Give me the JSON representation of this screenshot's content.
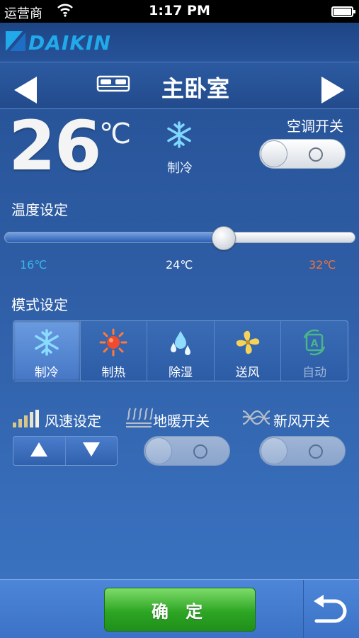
{
  "status": {
    "carrier": "运营商",
    "time": "1:17 PM"
  },
  "brand": {
    "name": "DAIKIN"
  },
  "room": {
    "title": "主卧室"
  },
  "current": {
    "temperature": "26",
    "unit": "℃",
    "mode_label": "制冷"
  },
  "power": {
    "label": "空调开关",
    "on": false
  },
  "temperature_setting": {
    "label": "温度设定",
    "min_label": "16℃",
    "mid_label": "24℃",
    "max_label": "32℃",
    "min": 16,
    "max": 32,
    "value": 26,
    "colors": {
      "min": "#39b7ea",
      "mid": "#ffffff",
      "max": "#f2743a"
    }
  },
  "mode_setting": {
    "label": "模式设定",
    "modes": [
      {
        "label": "制冷",
        "icon": "snowflake-icon",
        "active": true
      },
      {
        "label": "制热",
        "icon": "sun-icon",
        "active": false
      },
      {
        "label": "除湿",
        "icon": "water-drops-icon",
        "active": false
      },
      {
        "label": "送风",
        "icon": "fan-icon",
        "active": false
      },
      {
        "label": "自动",
        "icon": "auto-icon",
        "active": false,
        "disabled": true
      }
    ]
  },
  "features": {
    "fan_speed": {
      "label": "风速设定",
      "icon": "signal-bars-icon"
    },
    "floor_heating": {
      "label": "地暖开关",
      "icon": "floor-heating-icon",
      "on": false
    },
    "fresh_air": {
      "label": "新风开关",
      "icon": "fresh-air-icon",
      "on": false
    }
  },
  "footer": {
    "confirm_label": "确 定",
    "back_icon": "return-arrow-icon"
  }
}
